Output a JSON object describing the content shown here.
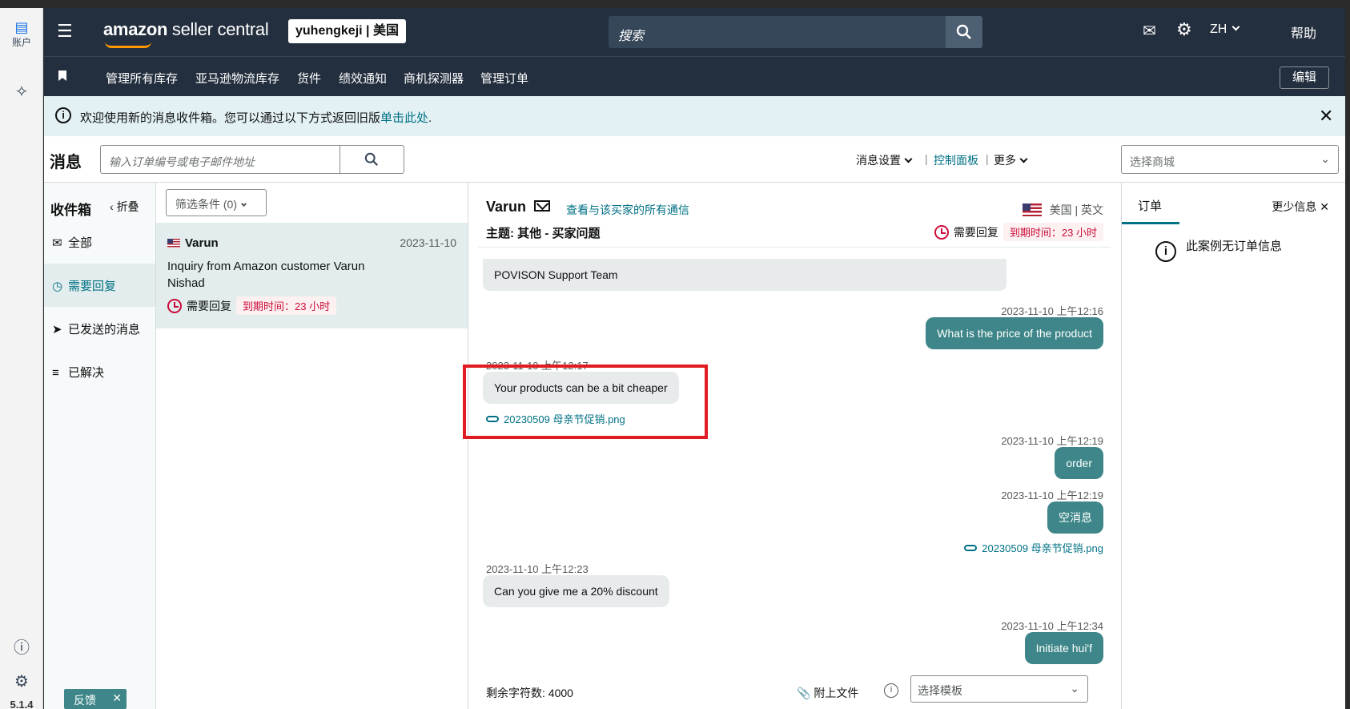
{
  "rail": {
    "account_label": "账户",
    "version": "5.1.4"
  },
  "topbar": {
    "logo_word1": "amazon",
    "logo_word2": "seller central",
    "store_chip": "yuhengkeji | 美国",
    "search_placeholder": "搜索",
    "lang": "ZH",
    "help": "帮助"
  },
  "nav": {
    "items": [
      "管理所有库存",
      "亚马逊物流库存",
      "货件",
      "绩效通知",
      "商机探测器",
      "管理订单"
    ],
    "edit": "编辑"
  },
  "banner": {
    "text": "欢迎使用新的消息收件箱。您可以通过以下方式返回旧版",
    "link": "单击此处",
    "period": "."
  },
  "messages_header": {
    "title": "消息",
    "search_placeholder": "输入订单编号或电子邮件地址",
    "settings": "消息设置",
    "dashboard": "控制面板",
    "more": "更多",
    "pipe": "|",
    "store_placeholder": "选择商城"
  },
  "inbox": {
    "title": "收件箱",
    "collapse": "折叠",
    "items": [
      {
        "label": "全部",
        "icon": "mail-icon"
      },
      {
        "label": "需要回复",
        "icon": "clock-icon"
      },
      {
        "label": "已发送的消息",
        "icon": "send-icon"
      },
      {
        "label": "已解决",
        "icon": "resolved-icon"
      }
    ]
  },
  "thread_list": {
    "filter": "筛选条件 (0)",
    "threads": [
      {
        "name": "Varun",
        "date": "2023-11-10",
        "subject": "Inquiry from Amazon customer Varun Nishad",
        "status": "需要回复",
        "due": "到期时间：23 小时"
      }
    ]
  },
  "conversation": {
    "buyer": "Varun",
    "view_all": "查看与该买家的所有通信",
    "country": "美国",
    "language": "英文",
    "subject": "主题: 其他 - 买家问题",
    "status": "需要回复",
    "due": "到期时间：23 小时",
    "messages": [
      {
        "text": "POVISON Support Team"
      },
      {
        "time": "2023-11-10 上午12:16",
        "text": "What is the price of the product"
      },
      {
        "time": "2023-11-10 上午12:17",
        "text": "Your products can be a bit cheaper",
        "attachment": "20230509 母亲节促销.png"
      },
      {
        "time": "2023-11-10 上午12:19",
        "text": "order"
      },
      {
        "time": "2023-11-10 上午12:19",
        "text": "空消息",
        "attachment": "20230509 母亲节促销.png"
      },
      {
        "time": "2023-11-10 上午12:23",
        "text": "Can you give me a 20% discount"
      },
      {
        "time": "2023-11-10 上午12:34",
        "text": "Initiate hui'f"
      }
    ],
    "remaining": "剩余字符数: 4000",
    "attach_file": "附上文件",
    "template_placeholder": "选择模板"
  },
  "right_panel": {
    "tab": "订单",
    "less_info": "更少信息",
    "no_order": "此案例无订单信息"
  },
  "feedback": "反馈",
  "colors": {
    "header_bg": "#232f3e",
    "accent_teal": "#3e8689",
    "link": "#007185",
    "alert_red": "#cc0c39",
    "highlight_box": "#e11b22"
  }
}
